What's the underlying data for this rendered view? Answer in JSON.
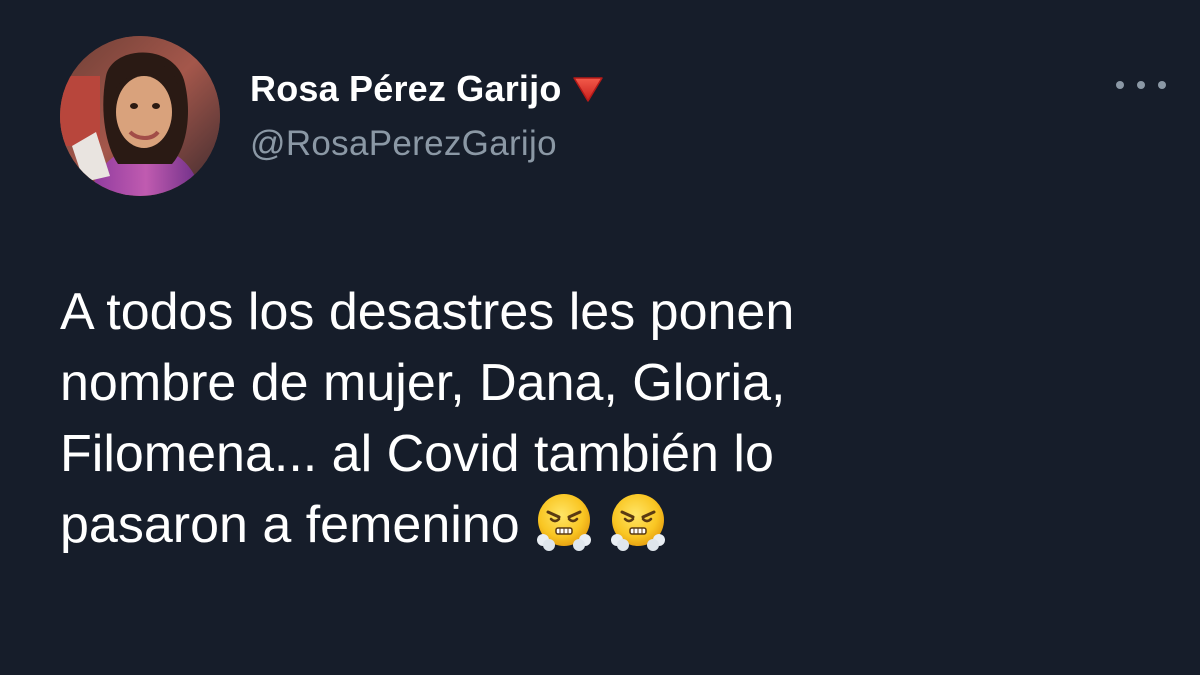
{
  "tweet": {
    "display_name": "Rosa Pérez Garijo",
    "badge_icon": "red-triangle-down-icon",
    "handle": "@RosaPerezGarijo",
    "more_icon": "more-options-icon",
    "text_lines": [
      "A todos los desastres les ponen",
      "nombre de mujer, Dana, Gloria,",
      "Filomena... al Covid también lo",
      "pasaron a femenino"
    ],
    "emojis": [
      "face-with-steam-from-nose-icon",
      "face-with-steam-from-nose-icon"
    ]
  },
  "colors": {
    "background": "#161d2a",
    "name": "#ffffff",
    "handle": "#8b98a5",
    "badge": "#e8312c"
  }
}
